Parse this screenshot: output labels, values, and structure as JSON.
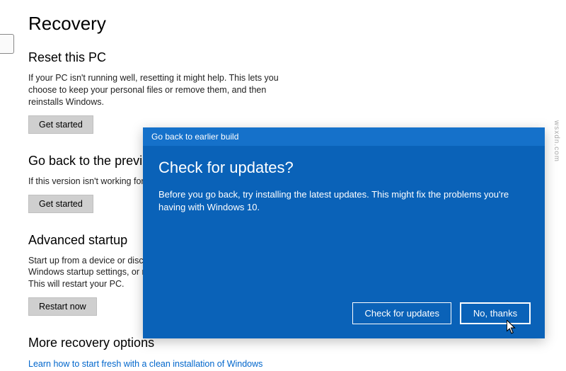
{
  "page": {
    "title": "Recovery"
  },
  "reset": {
    "title": "Reset this PC",
    "desc": "If your PC isn't running well, resetting it might help. This lets you choose to keep your personal files or remove them, and then reinstalls Windows.",
    "button": "Get started"
  },
  "goback": {
    "title": "Go back to the previ",
    "desc": "If this version isn't working for",
    "button": "Get started"
  },
  "advanced": {
    "title": "Advanced startup",
    "desc": "Start up from a device or disc (\nWindows startup settings, or re\nThis will restart your PC.",
    "button": "Restart now"
  },
  "more": {
    "title": "More recovery options",
    "link": "Learn how to start fresh with a clean installation of Windows"
  },
  "dialog": {
    "header": "Go back to earlier build",
    "title": "Check for updates?",
    "text": "Before you go back, try installing the latest updates. This might fix the problems you're having with Windows 10.",
    "check_btn": "Check for updates",
    "no_btn": "No, thanks"
  },
  "watermark": "wsxdn.com"
}
